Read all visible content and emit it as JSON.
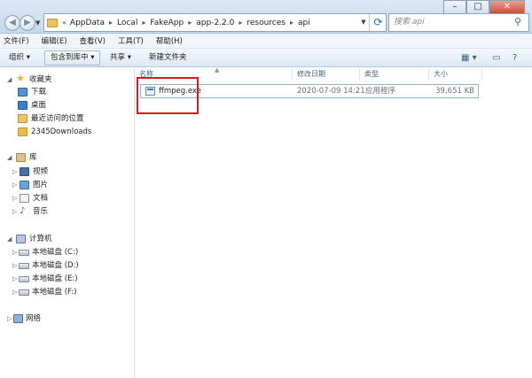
{
  "address": {
    "history_chevron": "«",
    "crumbs": [
      "AppData",
      "Local",
      "FakeApp",
      "app-2.2.0",
      "resources",
      "api"
    ],
    "separator": "▸"
  },
  "search": {
    "placeholder": "搜索 api"
  },
  "menu": [
    "文件(F)",
    "编辑(E)",
    "查看(V)",
    "工具(T)",
    "帮助(H)"
  ],
  "toolbar": {
    "organize": "组织 ▾",
    "include_library": "包含到库中 ▾",
    "share": "共享 ▾",
    "new_folder": "新建文件夹"
  },
  "sidebar": {
    "favorites": {
      "label": "收藏夹",
      "items": [
        "下载",
        "桌面",
        "最近访问的位置",
        "2345Downloads"
      ]
    },
    "libraries": {
      "label": "库",
      "items": [
        "视频",
        "图片",
        "文档",
        "音乐"
      ]
    },
    "computer": {
      "label": "计算机",
      "items": [
        "本地磁盘 (C:)",
        "本地磁盘 (D:)",
        "本地磁盘 (E:)",
        "本地磁盘 (F:)"
      ]
    },
    "network": {
      "label": "网络"
    }
  },
  "columns": {
    "name": "名称",
    "modified": "修改日期",
    "type": "类型",
    "size": "大小"
  },
  "files": [
    {
      "name": "ffmpeg.exe",
      "modified": "2020-07-09 14:21",
      "type": "应用程序",
      "size": "39,651 KB"
    }
  ],
  "colors": {
    "highlight_box": "#d7191f",
    "selection_border": "#8fb2da"
  }
}
